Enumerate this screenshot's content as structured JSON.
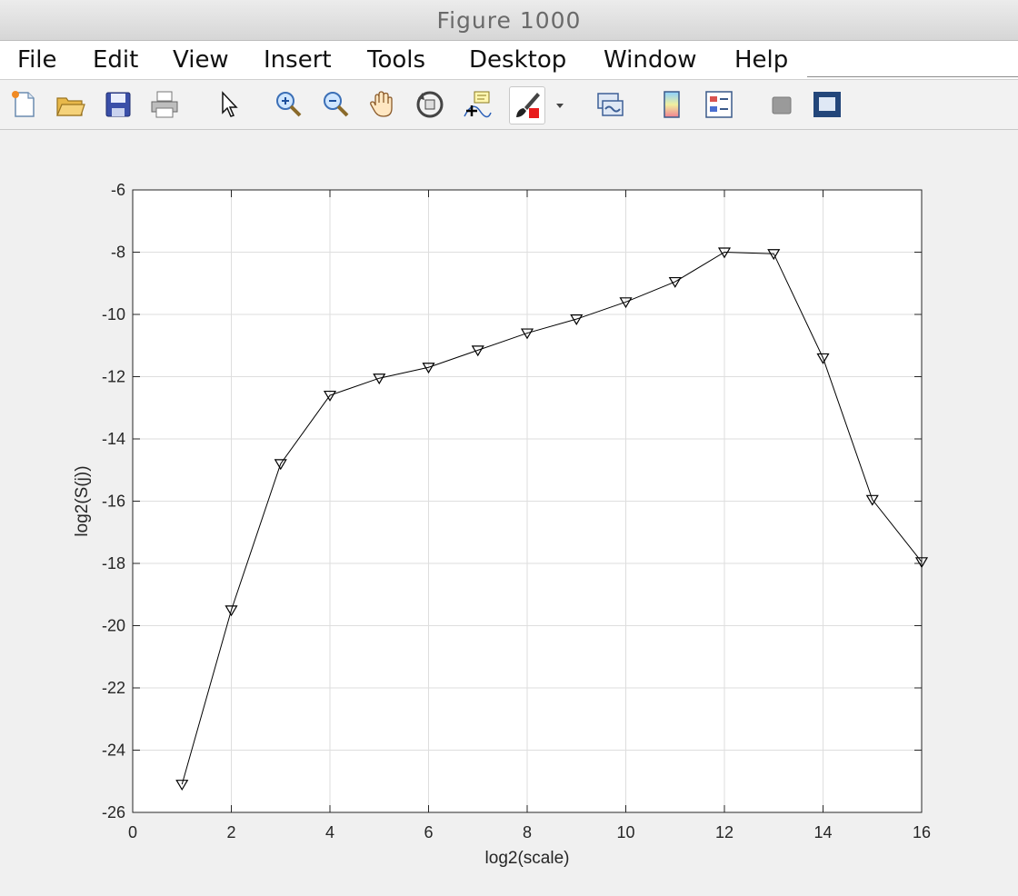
{
  "window": {
    "title": "Figure 1000"
  },
  "menu": {
    "items": [
      "File",
      "Edit",
      "View",
      "Insert",
      "Tools",
      "Desktop",
      "Window",
      "Help"
    ]
  },
  "toolbar": {
    "buttons": [
      "new-figure-icon",
      "open-file-icon",
      "save-icon",
      "print-icon",
      "pointer-icon",
      "zoom-in-icon",
      "zoom-out-icon",
      "pan-hand-icon",
      "rotate-3d-icon",
      "data-cursor-icon",
      "brush-icon",
      "dropdown-arrow-icon",
      "link-plot-icon",
      "colorbar-icon",
      "legend-icon",
      "hide-plot-tools-icon",
      "show-plot-tools-icon"
    ]
  },
  "chart_data": {
    "type": "line",
    "x": [
      1,
      2,
      3,
      4,
      5,
      6,
      7,
      8,
      9,
      10,
      11,
      12,
      13,
      14,
      15,
      16
    ],
    "series": [
      {
        "values": [
          -25.1,
          -19.5,
          -14.8,
          -12.6,
          -12.05,
          -11.7,
          -11.15,
          -10.6,
          -10.15,
          -9.6,
          -8.95,
          -8.0,
          -8.05,
          -11.4,
          -15.95,
          -17.95
        ],
        "color": "#000000",
        "marker": "triangle-down"
      }
    ],
    "xlabel": "log2(scale)",
    "ylabel": "log2(S(j))",
    "xlim": [
      0,
      16
    ],
    "ylim": [
      -26,
      -6
    ],
    "xticks": [
      0,
      2,
      4,
      6,
      8,
      10,
      12,
      14,
      16
    ],
    "yticks": [
      -26,
      -24,
      -22,
      -20,
      -18,
      -16,
      -14,
      -12,
      -10,
      -8,
      -6
    ],
    "grid": true
  }
}
